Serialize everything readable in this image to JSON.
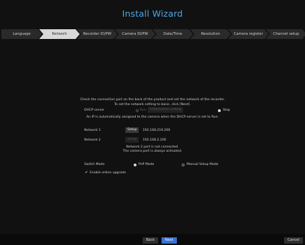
{
  "window": {
    "title": "Install Wizard"
  },
  "steps": [
    {
      "label": "Language",
      "active": false
    },
    {
      "label": "Network",
      "active": true
    },
    {
      "label": "Recorder ID/PW",
      "active": false
    },
    {
      "label": "Camera ID/PW",
      "active": false
    },
    {
      "label": "Date/Time",
      "active": false
    },
    {
      "label": "Resolution",
      "active": false
    },
    {
      "label": "Camera register",
      "active": false
    },
    {
      "label": "Channel setup",
      "active": false
    }
  ],
  "intro": {
    "line1": "Check the connection port on the back of the product and set the network of the recorder.",
    "line2": "To set the network setting to basic, click [Next]."
  },
  "dhcp": {
    "label": "DHCP server",
    "run_label": "Run",
    "setting_button": "Initialization setting",
    "stop_label": "Stop",
    "selected": "Stop",
    "note": "An IP is automatically assigned to the camera when the DHCP server is set to Run."
  },
  "network1": {
    "label": "Network 1",
    "button": "Setup",
    "ip": "192.168.219.200"
  },
  "network2": {
    "label": "Network 2",
    "button": "Setup",
    "ip": "192.168.2.200",
    "note_line1": "Network 2 port is not connected.",
    "note_line2": "The camera port is always activated."
  },
  "switch_mode": {
    "label": "Switch Mode",
    "option1": "PnP Mode",
    "option2": "Manual Setup Mode",
    "selected": "PnP Mode"
  },
  "online_upgrade": {
    "label": "Enable online upgrade",
    "checked": true,
    "check_glyph": "✔"
  },
  "footer": {
    "back": "Back",
    "next": "Next",
    "cancel": "Cancel"
  }
}
